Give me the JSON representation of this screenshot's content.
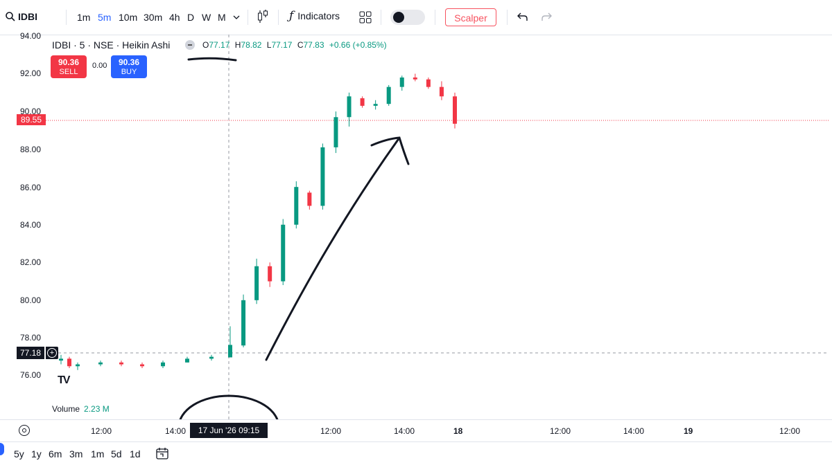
{
  "toolbar": {
    "symbol": "IDBI",
    "timeframes": [
      "1m",
      "5m",
      "10m",
      "30m",
      "4h",
      "D",
      "W",
      "M"
    ],
    "active_timeframe": "5m",
    "indicators_label": "Indicators",
    "scalper_label": "Scalper"
  },
  "legend": {
    "title": "IDBI · 5 · NSE · Heikin Ashi",
    "o_key": "O",
    "o_val": "77.17",
    "h_key": "H",
    "h_val": "78.82",
    "l_key": "L",
    "l_val": "77.17",
    "c_key": "C",
    "c_val": "77.83",
    "change": "+0.66 (+0.85%)"
  },
  "trade": {
    "sell_price": "90.36",
    "sell_label": "SELL",
    "spread": "0.00",
    "buy_price": "90.36",
    "buy_label": "BUY"
  },
  "price_axis": {
    "labels": [
      "94.00",
      "92.00",
      "90.00",
      "88.00",
      "86.00",
      "84.00",
      "82.00",
      "80.00",
      "78.00",
      "76.00"
    ],
    "last_price_tag": "89.55",
    "crosshair_price_tag": "77.18"
  },
  "volume": {
    "label": "Volume",
    "value": "2.23 M"
  },
  "time_axis": {
    "labels": [
      "12:00",
      "14:00",
      "12:00",
      "14:00",
      "18",
      "12:00",
      "14:00",
      "19",
      "12:00"
    ],
    "crosshair_time": "17 Jun '26  09:15"
  },
  "ranges": [
    "5y",
    "1y",
    "6m",
    "3m",
    "1m",
    "5d",
    "1d"
  ],
  "colors": {
    "up": "#089981",
    "down": "#f23645",
    "accent": "#2962ff"
  },
  "chart_data": {
    "type": "candlestick",
    "style": "Heikin Ashi",
    "interval": "5m",
    "ylim": [
      75.5,
      94.2
    ],
    "candles": [
      {
        "t": "16 Jun 09:15",
        "o": 77.0,
        "h": 77.3,
        "l": 76.8,
        "c": 77.1
      },
      {
        "t": "16 Jun 09:25",
        "o": 77.1,
        "h": 77.2,
        "l": 76.6,
        "c": 76.7
      },
      {
        "t": "16 Jun 09:35",
        "o": 76.7,
        "h": 76.9,
        "l": 76.5,
        "c": 76.8
      },
      {
        "t": "16 Jun 10:15",
        "o": 76.8,
        "h": 77.0,
        "l": 76.7,
        "c": 76.9
      },
      {
        "t": "16 Jun 11:00",
        "o": 76.9,
        "h": 77.0,
        "l": 76.7,
        "c": 76.8
      },
      {
        "t": "16 Jun 12:00",
        "o": 76.8,
        "h": 76.9,
        "l": 76.6,
        "c": 76.7
      },
      {
        "t": "16 Jun 13:00",
        "o": 76.7,
        "h": 77.0,
        "l": 76.6,
        "c": 76.9
      },
      {
        "t": "16 Jun 14:00",
        "o": 76.9,
        "h": 77.2,
        "l": 76.9,
        "c": 77.1
      },
      {
        "t": "16 Jun 15:00",
        "o": 77.1,
        "h": 77.3,
        "l": 77.0,
        "c": 77.2
      },
      {
        "t": "17 Jun 09:15",
        "o": 77.17,
        "h": 78.82,
        "l": 77.17,
        "c": 77.83
      },
      {
        "t": "17 Jun 09:30",
        "o": 77.8,
        "h": 80.5,
        "l": 77.7,
        "c": 80.2
      },
      {
        "t": "17 Jun 09:45",
        "o": 80.2,
        "h": 82.4,
        "l": 80.0,
        "c": 82.0
      },
      {
        "t": "17 Jun 10:00",
        "o": 82.0,
        "h": 82.2,
        "l": 80.9,
        "c": 81.2
      },
      {
        "t": "17 Jun 10:15",
        "o": 81.2,
        "h": 84.5,
        "l": 81.0,
        "c": 84.2
      },
      {
        "t": "17 Jun 10:30",
        "o": 84.2,
        "h": 86.5,
        "l": 84.0,
        "c": 86.2
      },
      {
        "t": "17 Jun 10:45",
        "o": 85.9,
        "h": 86.0,
        "l": 85.0,
        "c": 85.2
      },
      {
        "t": "17 Jun 11:00",
        "o": 85.2,
        "h": 88.5,
        "l": 85.0,
        "c": 88.3
      },
      {
        "t": "17 Jun 11:15",
        "o": 88.3,
        "h": 90.2,
        "l": 88.0,
        "c": 89.9
      },
      {
        "t": "17 Jun 11:30",
        "o": 89.9,
        "h": 91.2,
        "l": 89.4,
        "c": 91.0
      },
      {
        "t": "17 Jun 12:00",
        "o": 90.9,
        "h": 91.0,
        "l": 90.4,
        "c": 90.5
      },
      {
        "t": "17 Jun 12:30",
        "o": 90.5,
        "h": 90.8,
        "l": 90.3,
        "c": 90.6
      },
      {
        "t": "17 Jun 13:00",
        "o": 90.6,
        "h": 91.6,
        "l": 90.5,
        "c": 91.5
      },
      {
        "t": "17 Jun 13:30",
        "o": 91.5,
        "h": 92.1,
        "l": 91.3,
        "c": 92.0
      },
      {
        "t": "17 Jun 14:00",
        "o": 92.0,
        "h": 92.2,
        "l": 91.8,
        "c": 91.9
      },
      {
        "t": "17 Jun 14:30",
        "o": 91.9,
        "h": 92.0,
        "l": 91.4,
        "c": 91.5
      },
      {
        "t": "17 Jun 15:00",
        "o": 91.5,
        "h": 91.8,
        "l": 90.8,
        "c": 91.0
      },
      {
        "t": "17 Jun 15:15",
        "o": 91.0,
        "h": 91.2,
        "l": 89.3,
        "c": 89.55
      }
    ]
  },
  "annotations": {
    "crosshair_time_circled": true,
    "hand_drawn_arrow": true,
    "legend_open_underlined": true
  }
}
